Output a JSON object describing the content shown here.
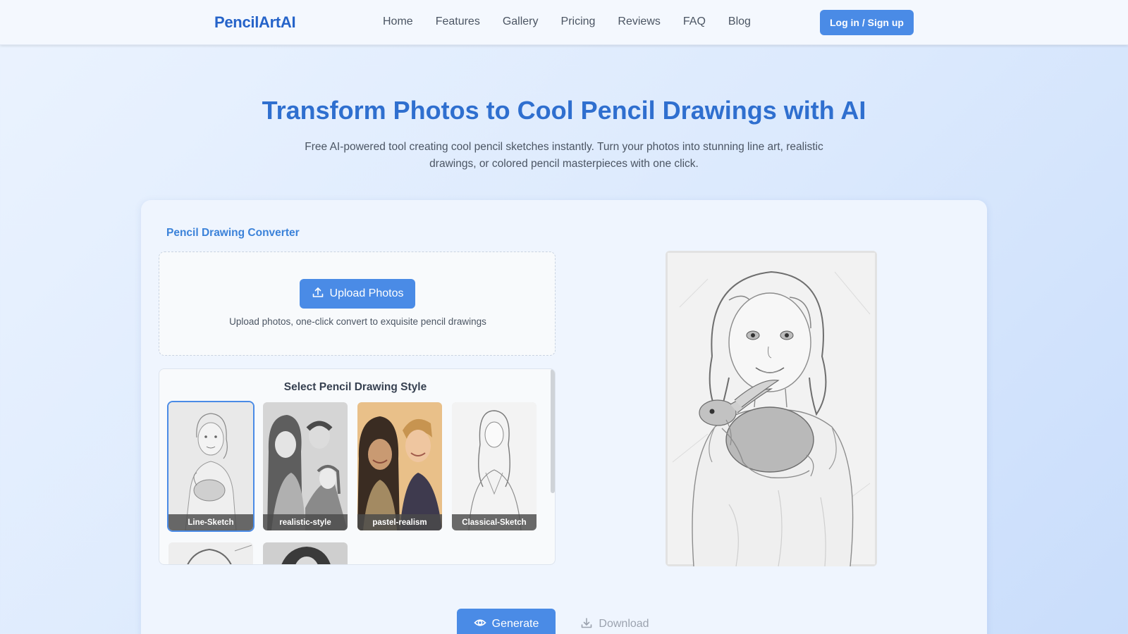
{
  "header": {
    "logo": "PencilArtAI",
    "nav": [
      "Home",
      "Features",
      "Gallery",
      "Pricing",
      "Reviews",
      "FAQ",
      "Blog"
    ],
    "login_label": "Log in / Sign up"
  },
  "hero": {
    "title": "Transform Photos to Cool Pencil Drawings with AI",
    "subtitle": "Free AI-powered tool creating cool pencil sketches instantly. Turn your photos into stunning line art, realistic drawings, or colored pencil masterpieces with one click."
  },
  "converter": {
    "title": "Pencil Drawing Converter",
    "upload_label": "Upload Photos",
    "upload_hint": "Upload photos, one-click convert to exquisite pencil drawings",
    "style_title": "Select Pencil Drawing Style",
    "styles": [
      {
        "label": "Line-Sketch",
        "selected": true
      },
      {
        "label": "realistic-style",
        "selected": false
      },
      {
        "label": "pastel-realism",
        "selected": false
      },
      {
        "label": "Classical-Sketch",
        "selected": false
      }
    ],
    "generate_label": "Generate",
    "download_label": "Download"
  },
  "colors": {
    "accent": "#4a8be6",
    "title": "#2f6fcf",
    "logo": "#2563c9"
  },
  "icons": {
    "upload": "upload-icon",
    "generate": "eye-icon",
    "download": "download-icon"
  }
}
